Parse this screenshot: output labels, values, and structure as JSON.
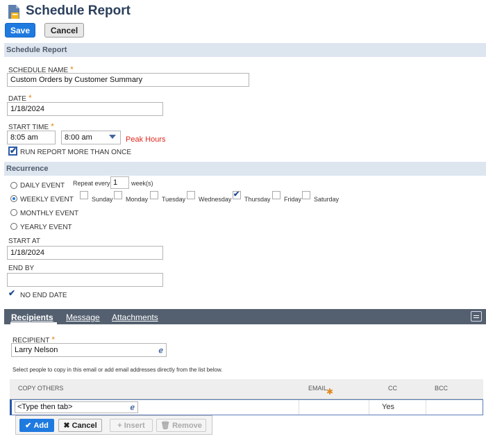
{
  "page": {
    "title": "Schedule Report"
  },
  "toolbar": {
    "save_label": "Save",
    "cancel_label": "Cancel"
  },
  "schedule": {
    "section_title": "Schedule Report",
    "name_label": "SCHEDULE NAME",
    "name_value": "Custom Orders by Customer Summary",
    "date_label": "DATE",
    "date_value": "1/18/2024",
    "start_time_label": "START TIME",
    "start_time_value": "8:05 am",
    "start_time_select": "8:00 am",
    "peak_hours": "Peak Hours",
    "run_more_label": "RUN REPORT MORE THAN ONCE",
    "run_more_checked": true
  },
  "recurrence": {
    "section_title": "Recurrence",
    "options": [
      "DAILY EVENT",
      "WEEKLY EVENT",
      "MONTHLY EVENT",
      "YEARLY EVENT"
    ],
    "selected": "WEEKLY EVENT",
    "repeat_every_label": "Repeat every",
    "repeat_every_value": "1",
    "repeat_unit": "week(s)",
    "days": [
      {
        "label": "Sunday",
        "checked": false
      },
      {
        "label": "Monday",
        "checked": false
      },
      {
        "label": "Tuesday",
        "checked": false
      },
      {
        "label": "Wednesday",
        "checked": false
      },
      {
        "label": "Thursday",
        "checked": true
      },
      {
        "label": "Friday",
        "checked": false
      },
      {
        "label": "Saturday",
        "checked": false
      }
    ],
    "start_at_label": "START AT",
    "start_at_value": "1/18/2024",
    "end_by_label": "END BY",
    "end_by_value": "",
    "no_end_date_label": "NO END DATE",
    "no_end_date_checked": true
  },
  "tabs": {
    "items": [
      "Recipients",
      "Message",
      "Attachments"
    ],
    "active": "Recipients"
  },
  "recipients": {
    "recipient_label": "RECIPIENT",
    "recipient_value": "Larry Nelson",
    "help_text": "Select people to copy in this email or add email addresses directly from the list below.",
    "columns": {
      "copy_others": "COPY OTHERS",
      "email": "EMAIL",
      "cc": "CC",
      "bcc": "BCC"
    },
    "row": {
      "copy_placeholder": "<Type then tab>",
      "cc": "Yes"
    },
    "buttons": {
      "add": "Add",
      "cancel": "Cancel",
      "insert": "Insert",
      "remove": "Remove"
    }
  },
  "colors": {
    "accent": "#1f7ae0",
    "section_bg": "#dde5ef",
    "tab_bar": "#546070",
    "peak": "#e0281c",
    "required": "#e0881c"
  }
}
